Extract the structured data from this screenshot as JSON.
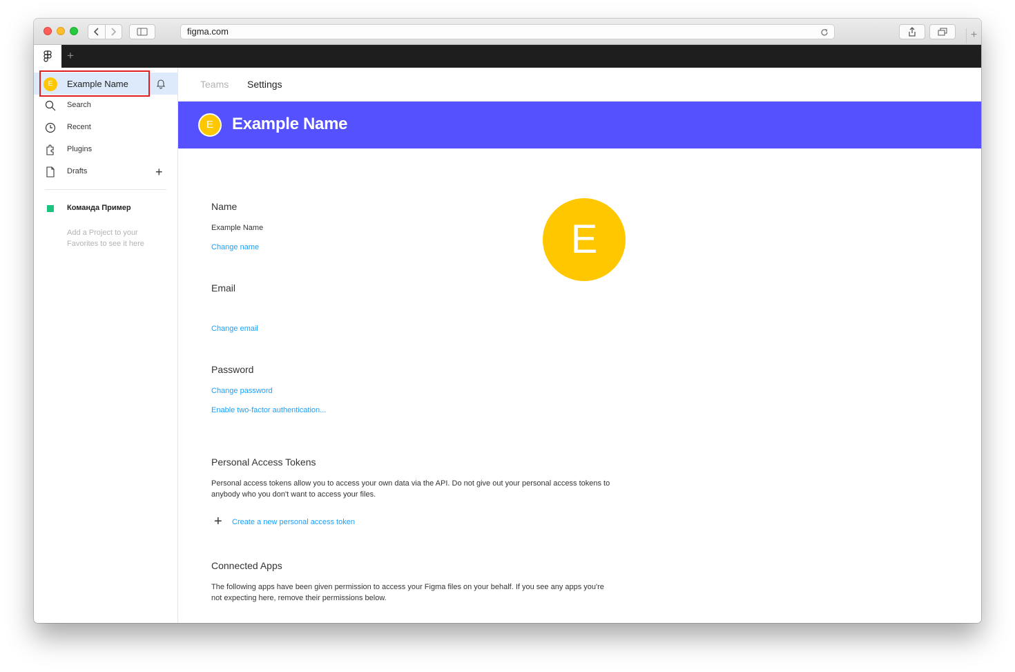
{
  "browser": {
    "url": "figma.com"
  },
  "sidebar": {
    "user": {
      "initial": "E",
      "name": "Example Name"
    },
    "items": [
      {
        "label": "Search",
        "icon": "search-icon"
      },
      {
        "label": "Recent",
        "icon": "clock-icon"
      },
      {
        "label": "Plugins",
        "icon": "plugin-icon"
      },
      {
        "label": "Drafts",
        "icon": "file-icon"
      }
    ],
    "team": {
      "name": "Команда Пример",
      "color": "#1bc47d"
    },
    "favorites_hint": "Add a Project to your Favorites to see it here"
  },
  "main": {
    "tabs": [
      "Teams",
      "Settings"
    ],
    "banner": {
      "initial": "E",
      "name": "Example Name",
      "color": "#5551ff"
    },
    "big_avatar_initial": "E",
    "name_section": {
      "title": "Name",
      "value": "Example Name",
      "link": "Change name"
    },
    "email_section": {
      "title": "Email",
      "link": "Change email"
    },
    "password_section": {
      "title": "Password",
      "link": "Change password",
      "two_factor_link": "Enable two-factor authentication..."
    },
    "tokens_section": {
      "title": "Personal Access Tokens",
      "description": "Personal access tokens allow you to access your own data via the API. Do not give out your personal access tokens to anybody who you don't want to access your files.",
      "create_link": "Create a new personal access token"
    },
    "apps_section": {
      "title": "Connected Apps",
      "description": "The following apps have been given permission to access your Figma files on your behalf. If you see any apps you're not expecting here, remove their permissions below."
    }
  },
  "colors": {
    "accent": "#5551ff",
    "avatar": "#ffc700",
    "link": "#18a0fb",
    "highlight": "#e01e1e"
  }
}
